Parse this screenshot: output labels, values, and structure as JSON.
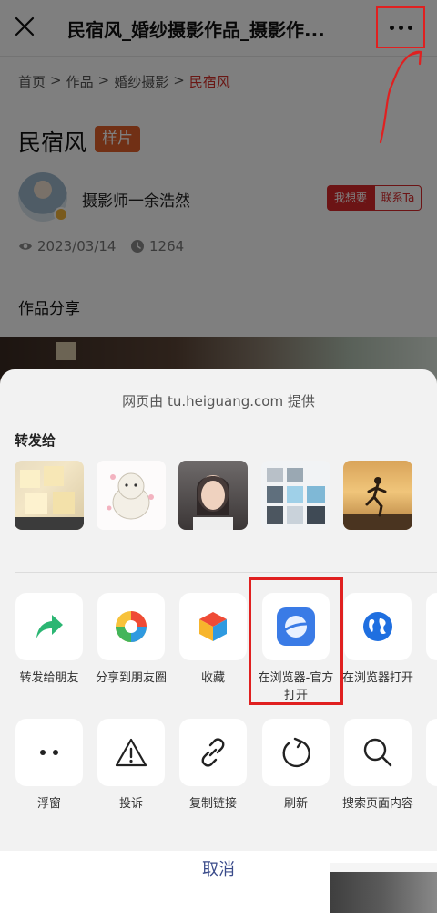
{
  "page": {
    "title": "民宿风_婚纱摄影作品_摄影作...",
    "breadcrumb": {
      "home": "首页",
      "sep1": ">",
      "works": "作品",
      "sep2": ">",
      "category": "婚纱摄影",
      "sep3": ">",
      "current": "民宿风"
    },
    "work_title": "民宿风",
    "work_badge": "样片",
    "author_name": "摄影师一余浩然",
    "want_button": "我想要",
    "contact_button": "联系Ta",
    "date": "2023/03/14",
    "views": "1264",
    "section_label": "作品分享"
  },
  "sheet": {
    "provider": "网页由 tu.heiguang.com 提供",
    "share_label": "转发给",
    "row1": [
      {
        "label": "转发给朋友",
        "icon": "forward-arrow-icon"
      },
      {
        "label": "分享到朋友圈",
        "icon": "moments-icon"
      },
      {
        "label": "收藏",
        "icon": "favorites-cube-icon"
      },
      {
        "label": "在浏览器-官方打开",
        "icon": "official-browser-icon"
      },
      {
        "label": "在浏览器打开",
        "icon": "globe-browser-icon"
      }
    ],
    "row2": [
      {
        "label": "浮窗",
        "icon": "float-window-icon"
      },
      {
        "label": "投诉",
        "icon": "warning-icon"
      },
      {
        "label": "复制链接",
        "icon": "link-icon"
      },
      {
        "label": "刷新",
        "icon": "refresh-icon"
      },
      {
        "label": "搜索页面内容",
        "icon": "search-icon"
      }
    ],
    "cancel": "取消"
  },
  "colors": {
    "accent_red": "#d4302b",
    "badge_orange": "#e3602a",
    "annotation_red": "#e02020",
    "cancel_blue": "#3a4b8a"
  }
}
